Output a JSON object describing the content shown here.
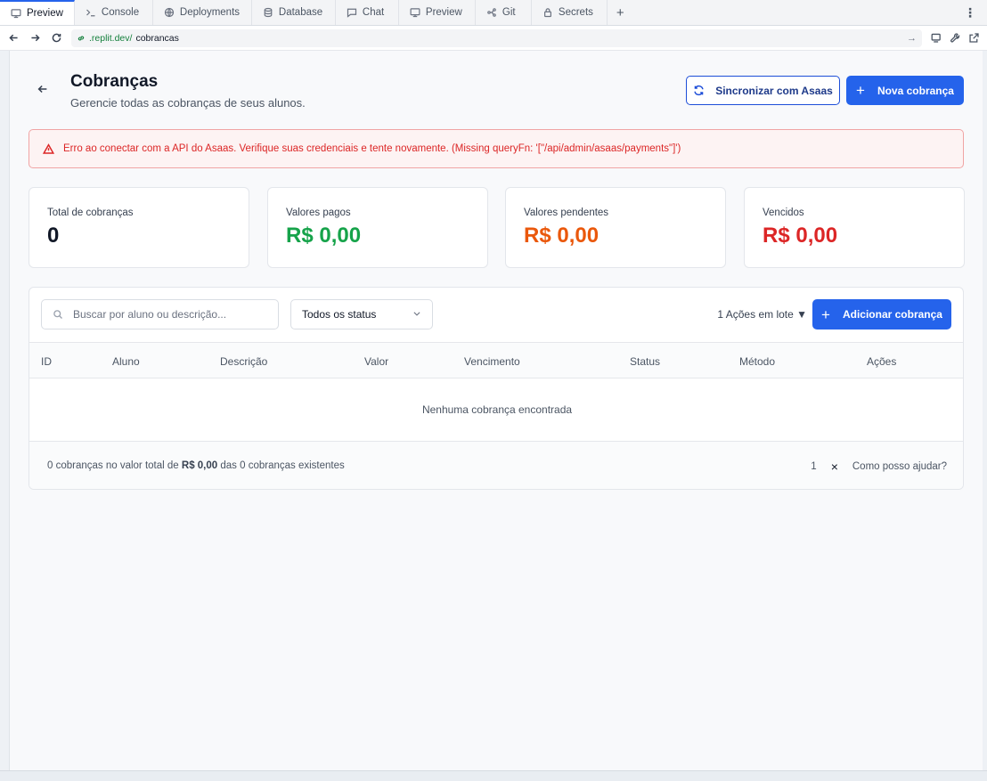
{
  "tabs": [
    {
      "label": "Preview",
      "icon": "monitor-icon",
      "active": true
    },
    {
      "label": "Console",
      "icon": "terminal-icon"
    },
    {
      "label": "Deployments",
      "icon": "globe-icon"
    },
    {
      "label": "Database",
      "icon": "database-icon"
    },
    {
      "label": "Chat",
      "icon": "chat-icon"
    },
    {
      "label": "Preview",
      "icon": "monitor-icon"
    },
    {
      "label": "Git",
      "icon": "git-icon"
    },
    {
      "label": "Secrets",
      "icon": "lock-icon"
    }
  ],
  "address": {
    "host": ".replit.dev/",
    "path": "cobrancas"
  },
  "header": {
    "title": "Cobranças",
    "subtitle": "Gerencie todas as cobranças de seus alunos.",
    "sync_label": "Sincronizar com Asaas",
    "new_label": "Nova cobrança"
  },
  "alert": {
    "message": "Erro ao conectar com a API do Asaas. Verifique suas credenciais e tente novamente. (Missing queryFn: '[\"/api/admin/asaas/payments\"]')"
  },
  "stats": [
    {
      "label": "Total de cobranças",
      "value": "0",
      "color": "#111827"
    },
    {
      "label": "Valores pagos",
      "value": "R$ 0,00",
      "color": "#16a34a"
    },
    {
      "label": "Valores pendentes",
      "value": "R$ 0,00",
      "color": "#ea580c"
    },
    {
      "label": "Vencidos",
      "value": "R$ 0,00",
      "color": "#dc2626"
    }
  ],
  "toolbar": {
    "search_placeholder": "Buscar por aluno ou descrição...",
    "status_value": "Todos os status",
    "bulk_label": "1 Ações em lote ▼",
    "add_label": "Adicionar cobrança"
  },
  "table": {
    "columns": [
      "ID",
      "Aluno",
      "Descrição",
      "Valor",
      "Vencimento",
      "Status",
      "Método",
      "Ações"
    ],
    "empty": "Nenhuma cobrança encontrada"
  },
  "footer": {
    "summary_prefix": "0 cobranças no valor total de",
    "summary_total": "R$ 0,00",
    "summary_suffix": "das 0 cobranças existentes",
    "count": "1",
    "close": "×",
    "help": "Como posso ajudar?"
  }
}
